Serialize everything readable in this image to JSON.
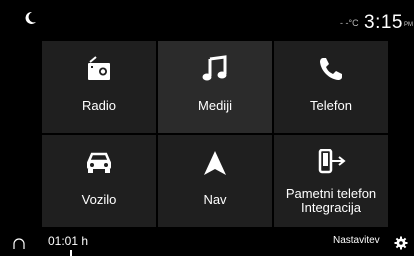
{
  "status": {
    "temperature": "- -°C",
    "time": "3:15",
    "ampm": "PM"
  },
  "tiles": [
    {
      "label": "Radio",
      "icon": "radio-icon"
    },
    {
      "label": "Mediji",
      "icon": "music-note-icon"
    },
    {
      "label": "Telefon",
      "icon": "phone-icon"
    },
    {
      "label": "Vozilo",
      "icon": "car-icon"
    },
    {
      "label": "Nav",
      "icon": "navigation-arrow-icon"
    },
    {
      "label": "Pametni telefon\nIntegracija",
      "icon": "smartphone-projection-icon"
    }
  ],
  "bottom": {
    "timer": "01:01 h",
    "settings_label": "Nastavitev"
  }
}
